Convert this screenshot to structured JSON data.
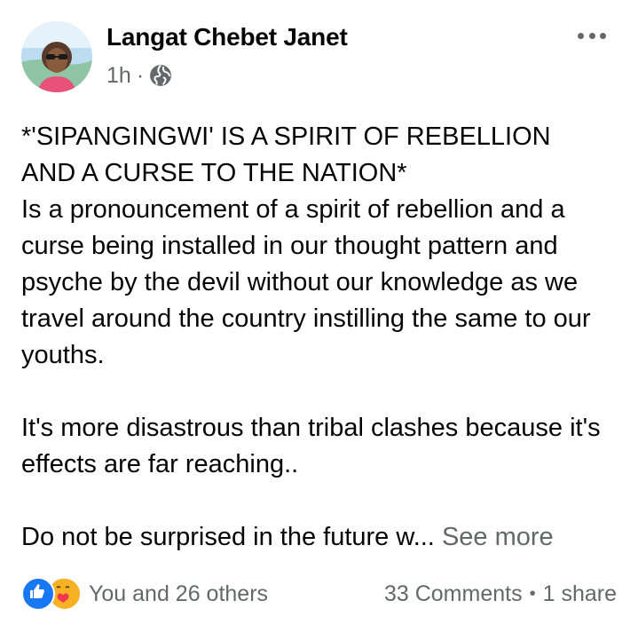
{
  "post": {
    "author_name": "Langat Chebet Janet",
    "timestamp": "1h",
    "meta_separator": "·",
    "privacy_icon": "globe-icon",
    "more_icon": "more-dots-icon",
    "text": {
      "heading_line1": "*'SIPANGINGWI' IS A SPIRIT OF REBELLION",
      "heading_line2": "AND A CURSE TO THE NATION*",
      "paragraph1": "Is a pronouncement of a spirit of rebellion and a curse being installed in our thought pattern and psyche by the devil without our knowledge as we travel around the country instilling the same to our youths.",
      "paragraph2": "It's more disastrous than tribal clashes because it's effects are far reaching..",
      "paragraph3": "Do not be surprised in the future w...",
      "see_more": "See more"
    }
  },
  "footer": {
    "reaction_icons": [
      "like-icon",
      "care-icon"
    ],
    "reactors": "You and 26 others",
    "comments": "33 Comments",
    "separator": "•",
    "shares": "1 share"
  },
  "colors": {
    "text_primary": "#050505",
    "text_secondary": "#65676b",
    "like_blue": "#1877f2",
    "care_yellow": "#f7b125"
  }
}
